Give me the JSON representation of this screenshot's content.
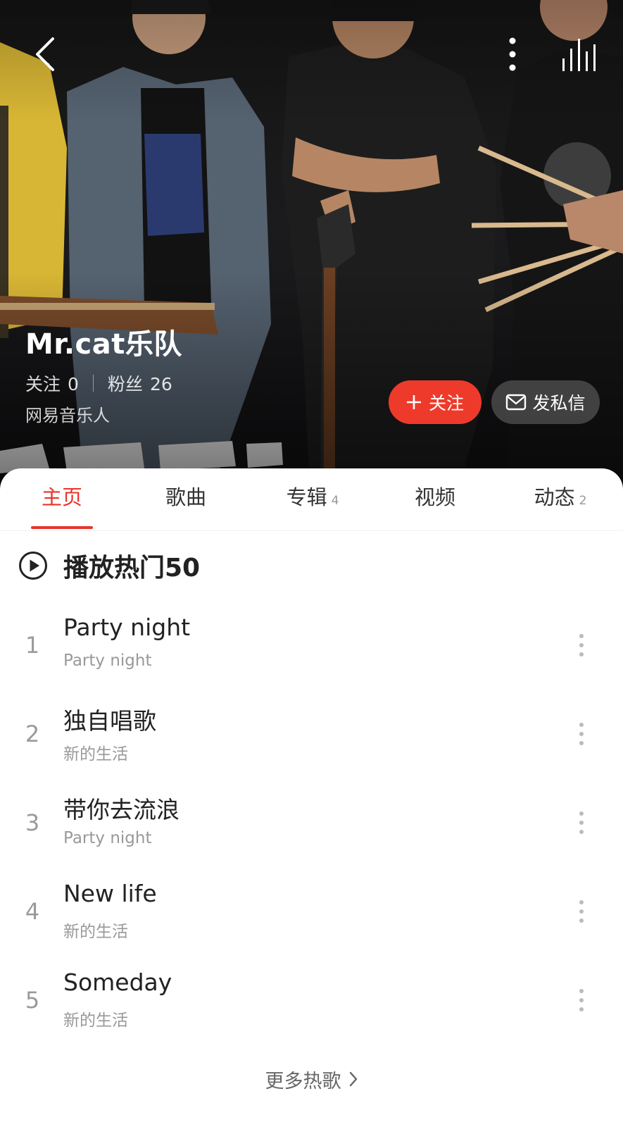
{
  "colors": {
    "accent": "#e8352a",
    "follow_button": "#ee3a2b",
    "text_primary": "#222222",
    "text_secondary": "#999999"
  },
  "header": {
    "back_icon": "chevron-left-icon",
    "more_icon": "vertical-dots-icon",
    "playing_icon": "equalizer-bars-icon"
  },
  "artist": {
    "name": "Mr.cat乐队",
    "following_label": "关注",
    "following_count": "0",
    "fans_label": "粉丝",
    "fans_count": "26",
    "tag": "网易音乐人"
  },
  "actions": {
    "follow_label": "关注",
    "follow_icon": "plus-icon",
    "message_label": "发私信",
    "message_icon": "envelope-icon"
  },
  "tabs": [
    {
      "label": "主页",
      "count": "",
      "active": true
    },
    {
      "label": "歌曲",
      "count": ""
    },
    {
      "label": "专辑",
      "count": "4"
    },
    {
      "label": "视频",
      "count": ""
    },
    {
      "label": "动态",
      "count": "2"
    }
  ],
  "hot": {
    "label": "播放热门50",
    "icon": "play-circle-icon"
  },
  "songs": [
    {
      "index": "1",
      "title": "Party night",
      "album": "Party night"
    },
    {
      "index": "2",
      "title": "独自唱歌",
      "album": "新的生活"
    },
    {
      "index": "3",
      "title": "带你去流浪",
      "album": "Party night"
    },
    {
      "index": "4",
      "title": "New life",
      "album": "新的生活"
    },
    {
      "index": "5",
      "title": "Someday",
      "album": "新的生活"
    }
  ],
  "more_songs": {
    "label": "更多热歌",
    "icon": "chevron-right-icon"
  }
}
